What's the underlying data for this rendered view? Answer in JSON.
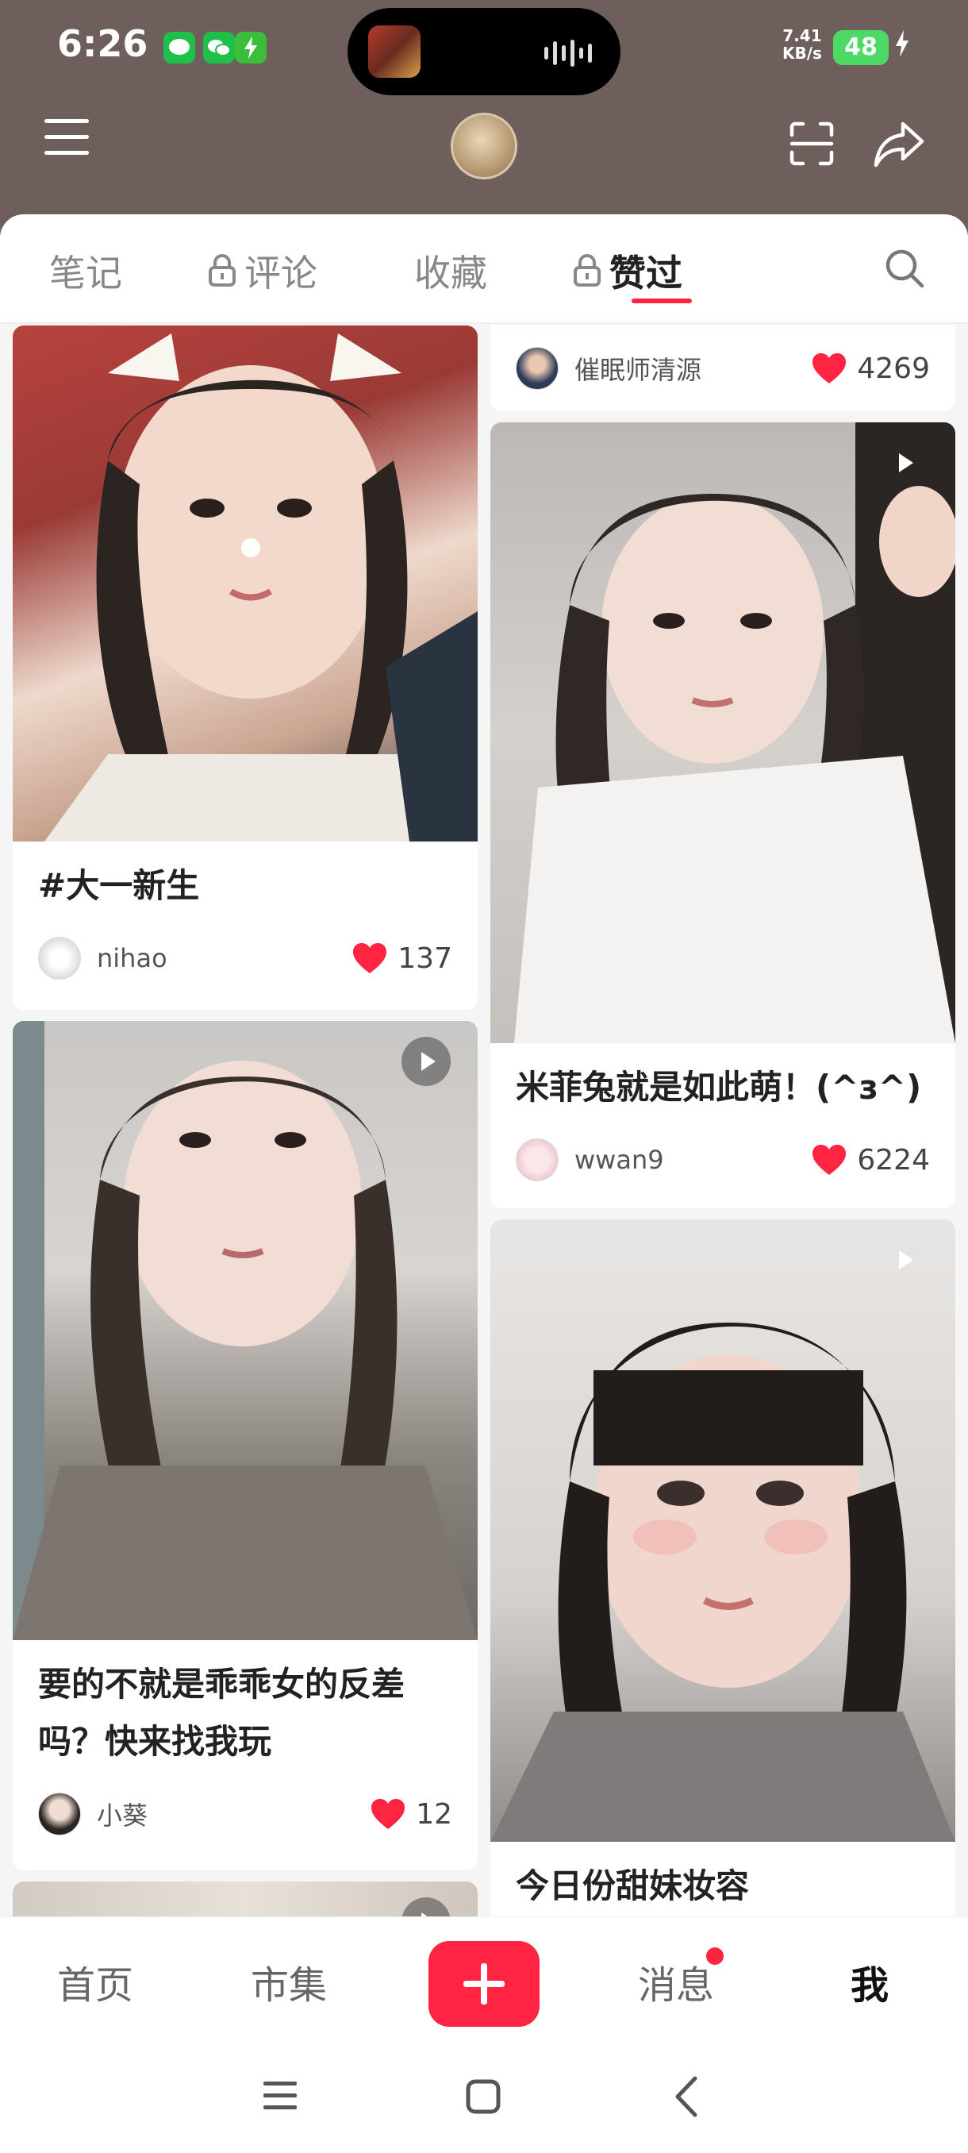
{
  "status_bar": {
    "time": "6:26",
    "net_speed_value": "7.41",
    "net_speed_unit": "KB/s",
    "battery": "48"
  },
  "tabs": [
    {
      "label": "笔记",
      "locked": false,
      "active": false
    },
    {
      "label": "评论",
      "locked": true,
      "active": false
    },
    {
      "label": "收藏",
      "locked": false,
      "active": false
    },
    {
      "label": "赞过",
      "locked": true,
      "active": true
    }
  ],
  "feed": {
    "left": [
      {
        "title": "#大一新生",
        "author": "nihao",
        "likes": "137",
        "video": false
      },
      {
        "title": "要的不就是乖乖女的反差吗？快来找我玩",
        "author": "小葵",
        "likes": "12",
        "video": true
      }
    ],
    "right": [
      {
        "author": "催眠师清源",
        "likes": "4269"
      },
      {
        "title": "米菲兔就是如此萌！(^з^)",
        "author": "wwan9",
        "likes": "6224",
        "video": true
      },
      {
        "title": "今日份甜妹妆容",
        "video": true
      }
    ]
  },
  "bottom_nav": {
    "home": "首页",
    "market": "市集",
    "messages": "消息",
    "me": "我",
    "publish_icon": "plus-icon"
  },
  "colors": {
    "accent": "#ff2442",
    "header_bg": "#6f5f5c"
  }
}
